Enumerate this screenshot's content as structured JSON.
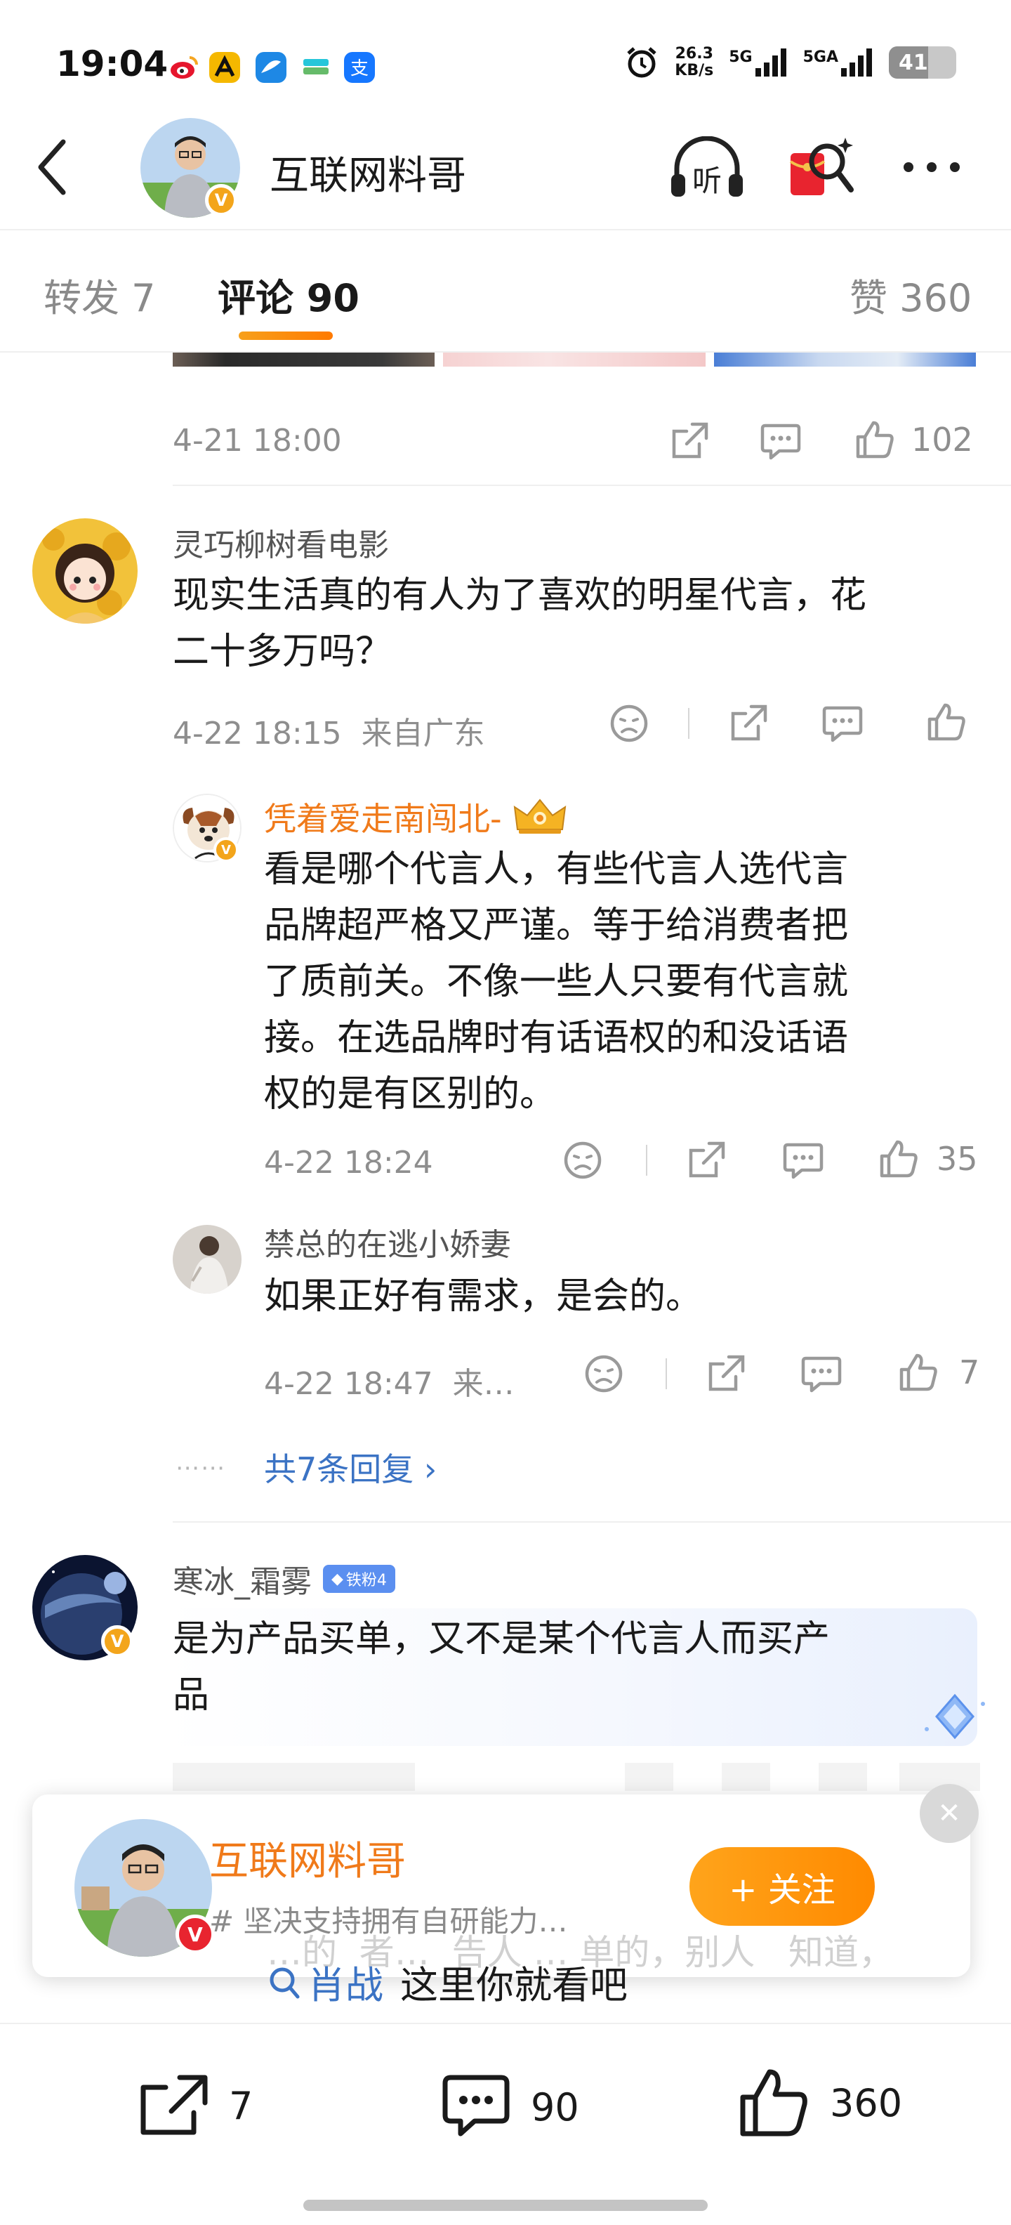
{
  "status_bar": {
    "time": "19:04",
    "net_speed": "26.3",
    "net_speed_unit": "KB/s",
    "signal_1": "5G",
    "signal_2": "5GA",
    "battery": "41",
    "app_icons": [
      "weibo-icon",
      "a-app-icon",
      "blue-app-icon",
      "cards-app-icon",
      "alipay-icon"
    ],
    "app_colors": [
      "#e6162d",
      "#f5b800",
      "#1e88e5",
      "#26c6da",
      "#1677ff"
    ]
  },
  "header": {
    "title": "互联网料哥",
    "listen_label": "听"
  },
  "tabs": {
    "repost": "转发 7",
    "comments": "评论 90",
    "likes": "赞 360"
  },
  "prev_post": {
    "time": "4-21 18:00",
    "like_count": "102"
  },
  "comment1": {
    "user": "灵巧柳树看电影",
    "text_line1": "现实生活真的有人为了喜欢的明星代言，花",
    "text_line2": "二十多万吗？",
    "meta": "4-22 18:15  来自广东"
  },
  "reply1": {
    "user": "凭着爱走南闯北-",
    "text_lines": [
      "看是哪个代言人，有些代言人选代言",
      "品牌超严格又严谨。等于给消费者把",
      "了质前关。不像一些人只要有代言就",
      "接。在选品牌时有话语权的和没话语",
      "权的是有区别的。"
    ],
    "meta": "4-22 18:24",
    "like_count": "35"
  },
  "reply2": {
    "user": "禁总的在逃小娇妻",
    "text": "如果正好有需求，是会的。",
    "meta": "4-22 18:47  来…",
    "like_count": "7"
  },
  "replies_link": "共7条回复 ›",
  "comment2": {
    "user": "寒冰_霜雾",
    "fan_badge": "铁粉4",
    "text_line1": "是为产品买单，又不是某个代言人而买产",
    "text_line2": "品"
  },
  "popup": {
    "name": "互联网料哥",
    "tag": "# 坚决支持拥有自研能力…",
    "follow_label": "+ 关注",
    "close": "✕",
    "behind_text": "…的  者…  告人 … 单的，别人   知道，",
    "search_keyword": "肖战",
    "search_tail": "这里你就看吧"
  },
  "bottom_bar": {
    "repost_count": "7",
    "comment_count": "90",
    "like_count": "360"
  },
  "accent_color": "#f07a1a"
}
